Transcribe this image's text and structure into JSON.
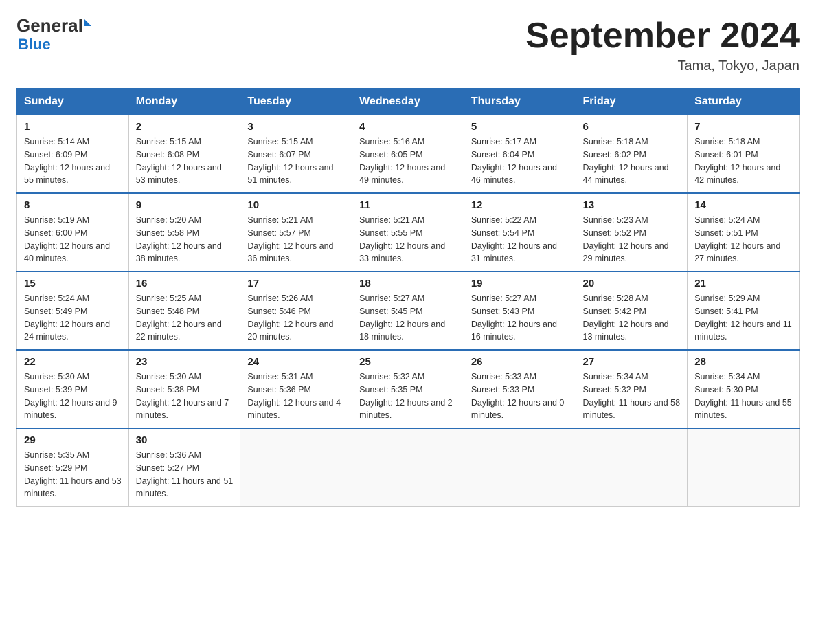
{
  "header": {
    "logo_text": "General",
    "logo_blue": "Blue",
    "month_title": "September 2024",
    "location": "Tama, Tokyo, Japan"
  },
  "days_of_week": [
    "Sunday",
    "Monday",
    "Tuesday",
    "Wednesday",
    "Thursday",
    "Friday",
    "Saturday"
  ],
  "weeks": [
    [
      {
        "day": "1",
        "sunrise": "5:14 AM",
        "sunset": "6:09 PM",
        "daylight": "12 hours and 55 minutes."
      },
      {
        "day": "2",
        "sunrise": "5:15 AM",
        "sunset": "6:08 PM",
        "daylight": "12 hours and 53 minutes."
      },
      {
        "day": "3",
        "sunrise": "5:15 AM",
        "sunset": "6:07 PM",
        "daylight": "12 hours and 51 minutes."
      },
      {
        "day": "4",
        "sunrise": "5:16 AM",
        "sunset": "6:05 PM",
        "daylight": "12 hours and 49 minutes."
      },
      {
        "day": "5",
        "sunrise": "5:17 AM",
        "sunset": "6:04 PM",
        "daylight": "12 hours and 46 minutes."
      },
      {
        "day": "6",
        "sunrise": "5:18 AM",
        "sunset": "6:02 PM",
        "daylight": "12 hours and 44 minutes."
      },
      {
        "day": "7",
        "sunrise": "5:18 AM",
        "sunset": "6:01 PM",
        "daylight": "12 hours and 42 minutes."
      }
    ],
    [
      {
        "day": "8",
        "sunrise": "5:19 AM",
        "sunset": "6:00 PM",
        "daylight": "12 hours and 40 minutes."
      },
      {
        "day": "9",
        "sunrise": "5:20 AM",
        "sunset": "5:58 PM",
        "daylight": "12 hours and 38 minutes."
      },
      {
        "day": "10",
        "sunrise": "5:21 AM",
        "sunset": "5:57 PM",
        "daylight": "12 hours and 36 minutes."
      },
      {
        "day": "11",
        "sunrise": "5:21 AM",
        "sunset": "5:55 PM",
        "daylight": "12 hours and 33 minutes."
      },
      {
        "day": "12",
        "sunrise": "5:22 AM",
        "sunset": "5:54 PM",
        "daylight": "12 hours and 31 minutes."
      },
      {
        "day": "13",
        "sunrise": "5:23 AM",
        "sunset": "5:52 PM",
        "daylight": "12 hours and 29 minutes."
      },
      {
        "day": "14",
        "sunrise": "5:24 AM",
        "sunset": "5:51 PM",
        "daylight": "12 hours and 27 minutes."
      }
    ],
    [
      {
        "day": "15",
        "sunrise": "5:24 AM",
        "sunset": "5:49 PM",
        "daylight": "12 hours and 24 minutes."
      },
      {
        "day": "16",
        "sunrise": "5:25 AM",
        "sunset": "5:48 PM",
        "daylight": "12 hours and 22 minutes."
      },
      {
        "day": "17",
        "sunrise": "5:26 AM",
        "sunset": "5:46 PM",
        "daylight": "12 hours and 20 minutes."
      },
      {
        "day": "18",
        "sunrise": "5:27 AM",
        "sunset": "5:45 PM",
        "daylight": "12 hours and 18 minutes."
      },
      {
        "day": "19",
        "sunrise": "5:27 AM",
        "sunset": "5:43 PM",
        "daylight": "12 hours and 16 minutes."
      },
      {
        "day": "20",
        "sunrise": "5:28 AM",
        "sunset": "5:42 PM",
        "daylight": "12 hours and 13 minutes."
      },
      {
        "day": "21",
        "sunrise": "5:29 AM",
        "sunset": "5:41 PM",
        "daylight": "12 hours and 11 minutes."
      }
    ],
    [
      {
        "day": "22",
        "sunrise": "5:30 AM",
        "sunset": "5:39 PM",
        "daylight": "12 hours and 9 minutes."
      },
      {
        "day": "23",
        "sunrise": "5:30 AM",
        "sunset": "5:38 PM",
        "daylight": "12 hours and 7 minutes."
      },
      {
        "day": "24",
        "sunrise": "5:31 AM",
        "sunset": "5:36 PM",
        "daylight": "12 hours and 4 minutes."
      },
      {
        "day": "25",
        "sunrise": "5:32 AM",
        "sunset": "5:35 PM",
        "daylight": "12 hours and 2 minutes."
      },
      {
        "day": "26",
        "sunrise": "5:33 AM",
        "sunset": "5:33 PM",
        "daylight": "12 hours and 0 minutes."
      },
      {
        "day": "27",
        "sunrise": "5:34 AM",
        "sunset": "5:32 PM",
        "daylight": "11 hours and 58 minutes."
      },
      {
        "day": "28",
        "sunrise": "5:34 AM",
        "sunset": "5:30 PM",
        "daylight": "11 hours and 55 minutes."
      }
    ],
    [
      {
        "day": "29",
        "sunrise": "5:35 AM",
        "sunset": "5:29 PM",
        "daylight": "11 hours and 53 minutes."
      },
      {
        "day": "30",
        "sunrise": "5:36 AM",
        "sunset": "5:27 PM",
        "daylight": "11 hours and 51 minutes."
      },
      null,
      null,
      null,
      null,
      null
    ]
  ]
}
